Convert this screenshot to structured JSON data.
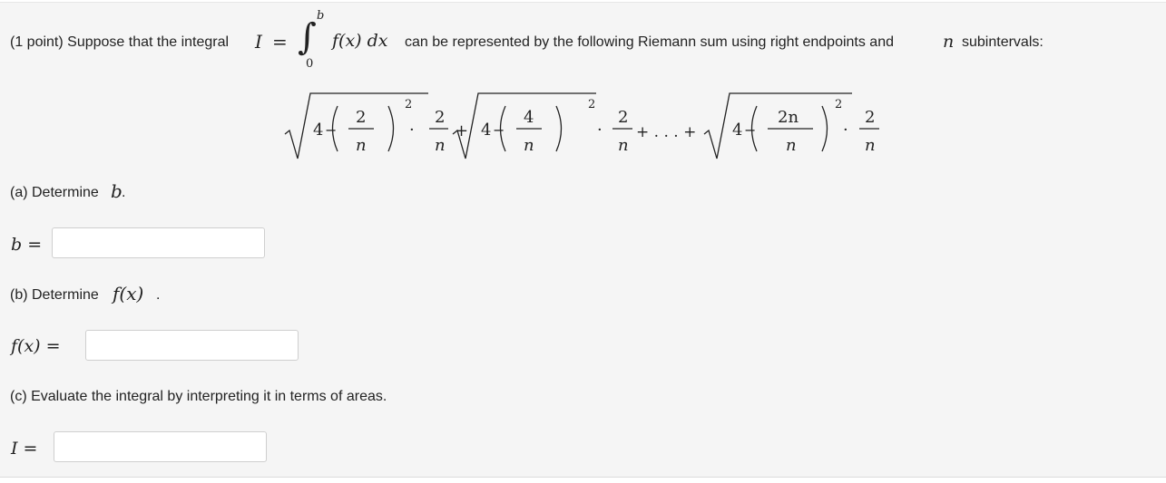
{
  "intro": {
    "prefix": "(1 point) Suppose that the integral",
    "I_symbol": "I",
    "equals": "=",
    "integral_lower": "0",
    "integral_upper": "b",
    "integrand": "f(x) dx",
    "suffix_a": "can be represented by the following Riemann sum using right endpoints and",
    "n_symbol": "n",
    "suffix_b": "subintervals:"
  },
  "riemann_sum": {
    "four": "4",
    "minus": "−",
    "plus": "+",
    "dots": "+ . . . +",
    "cdot": "·",
    "exp": "2",
    "terms": [
      {
        "num": "2",
        "den": "n"
      },
      {
        "num": "4",
        "den": "n"
      },
      {
        "num": "2n",
        "den": "n"
      }
    ],
    "factor": {
      "num": "2",
      "den": "n"
    }
  },
  "part_a": {
    "prompt": "(a) Determine",
    "variable": "b",
    "end": ".",
    "answer_label": "b =",
    "answer_value": ""
  },
  "part_b": {
    "prompt": "(b) Determine",
    "variable": "f(x)",
    "end": ".",
    "answer_label": "f(x) =",
    "answer_value": ""
  },
  "part_c": {
    "prompt": "(c) Evaluate the integral by interpreting it in terms of areas.",
    "answer_label": "I =",
    "answer_value": ""
  }
}
